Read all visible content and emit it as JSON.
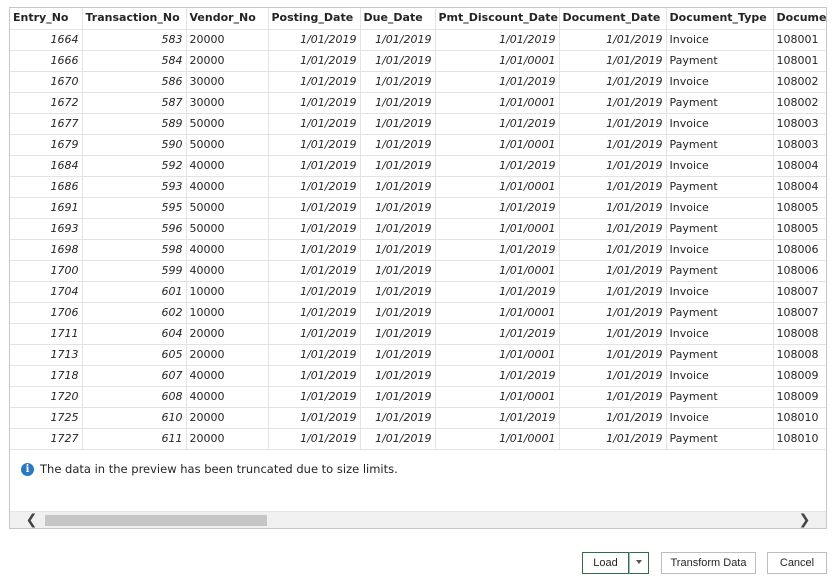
{
  "grid": {
    "columns": [
      "Entry_No",
      "Transaction_No",
      "Vendor_No",
      "Posting_Date",
      "Due_Date",
      "Pmt_Discount_Date",
      "Document_Date",
      "Document_Type",
      "Document"
    ],
    "rows": [
      [
        "1664",
        "583",
        "20000",
        "1/01/2019",
        "1/01/2019",
        "1/01/2019",
        "1/01/2019",
        "Invoice",
        "108001"
      ],
      [
        "1666",
        "584",
        "20000",
        "1/01/2019",
        "1/01/2019",
        "1/01/0001",
        "1/01/2019",
        "Payment",
        "108001"
      ],
      [
        "1670",
        "586",
        "30000",
        "1/01/2019",
        "1/01/2019",
        "1/01/2019",
        "1/01/2019",
        "Invoice",
        "108002"
      ],
      [
        "1672",
        "587",
        "30000",
        "1/01/2019",
        "1/01/2019",
        "1/01/0001",
        "1/01/2019",
        "Payment",
        "108002"
      ],
      [
        "1677",
        "589",
        "50000",
        "1/01/2019",
        "1/01/2019",
        "1/01/2019",
        "1/01/2019",
        "Invoice",
        "108003"
      ],
      [
        "1679",
        "590",
        "50000",
        "1/01/2019",
        "1/01/2019",
        "1/01/0001",
        "1/01/2019",
        "Payment",
        "108003"
      ],
      [
        "1684",
        "592",
        "40000",
        "1/01/2019",
        "1/01/2019",
        "1/01/2019",
        "1/01/2019",
        "Invoice",
        "108004"
      ],
      [
        "1686",
        "593",
        "40000",
        "1/01/2019",
        "1/01/2019",
        "1/01/0001",
        "1/01/2019",
        "Payment",
        "108004"
      ],
      [
        "1691",
        "595",
        "50000",
        "1/01/2019",
        "1/01/2019",
        "1/01/2019",
        "1/01/2019",
        "Invoice",
        "108005"
      ],
      [
        "1693",
        "596",
        "50000",
        "1/01/2019",
        "1/01/2019",
        "1/01/0001",
        "1/01/2019",
        "Payment",
        "108005"
      ],
      [
        "1698",
        "598",
        "40000",
        "1/01/2019",
        "1/01/2019",
        "1/01/2019",
        "1/01/2019",
        "Invoice",
        "108006"
      ],
      [
        "1700",
        "599",
        "40000",
        "1/01/2019",
        "1/01/2019",
        "1/01/0001",
        "1/01/2019",
        "Payment",
        "108006"
      ],
      [
        "1704",
        "601",
        "10000",
        "1/01/2019",
        "1/01/2019",
        "1/01/2019",
        "1/01/2019",
        "Invoice",
        "108007"
      ],
      [
        "1706",
        "602",
        "10000",
        "1/01/2019",
        "1/01/2019",
        "1/01/0001",
        "1/01/2019",
        "Payment",
        "108007"
      ],
      [
        "1711",
        "604",
        "20000",
        "1/01/2019",
        "1/01/2019",
        "1/01/2019",
        "1/01/2019",
        "Invoice",
        "108008"
      ],
      [
        "1713",
        "605",
        "20000",
        "1/01/2019",
        "1/01/2019",
        "1/01/0001",
        "1/01/2019",
        "Payment",
        "108008"
      ],
      [
        "1718",
        "607",
        "40000",
        "1/01/2019",
        "1/01/2019",
        "1/01/2019",
        "1/01/2019",
        "Invoice",
        "108009"
      ],
      [
        "1720",
        "608",
        "40000",
        "1/01/2019",
        "1/01/2019",
        "1/01/0001",
        "1/01/2019",
        "Payment",
        "108009"
      ],
      [
        "1725",
        "610",
        "20000",
        "1/01/2019",
        "1/01/2019",
        "1/01/2019",
        "1/01/2019",
        "Invoice",
        "108010"
      ],
      [
        "1727",
        "611",
        "20000",
        "1/01/2019",
        "1/01/2019",
        "1/01/0001",
        "1/01/2019",
        "Payment",
        "108010"
      ]
    ]
  },
  "notice": {
    "icon": "info-icon",
    "text": "The data in the preview has been truncated due to size limits."
  },
  "scrollbar": {
    "left_icon": "chevron-left-icon",
    "right_icon": "chevron-right-icon"
  },
  "buttons": {
    "load_label": "Load",
    "transform_label": "Transform Data",
    "cancel_label": "Cancel"
  },
  "colors": {
    "accent_border": "#2e6e4c",
    "info_icon": "#2b79c2"
  }
}
